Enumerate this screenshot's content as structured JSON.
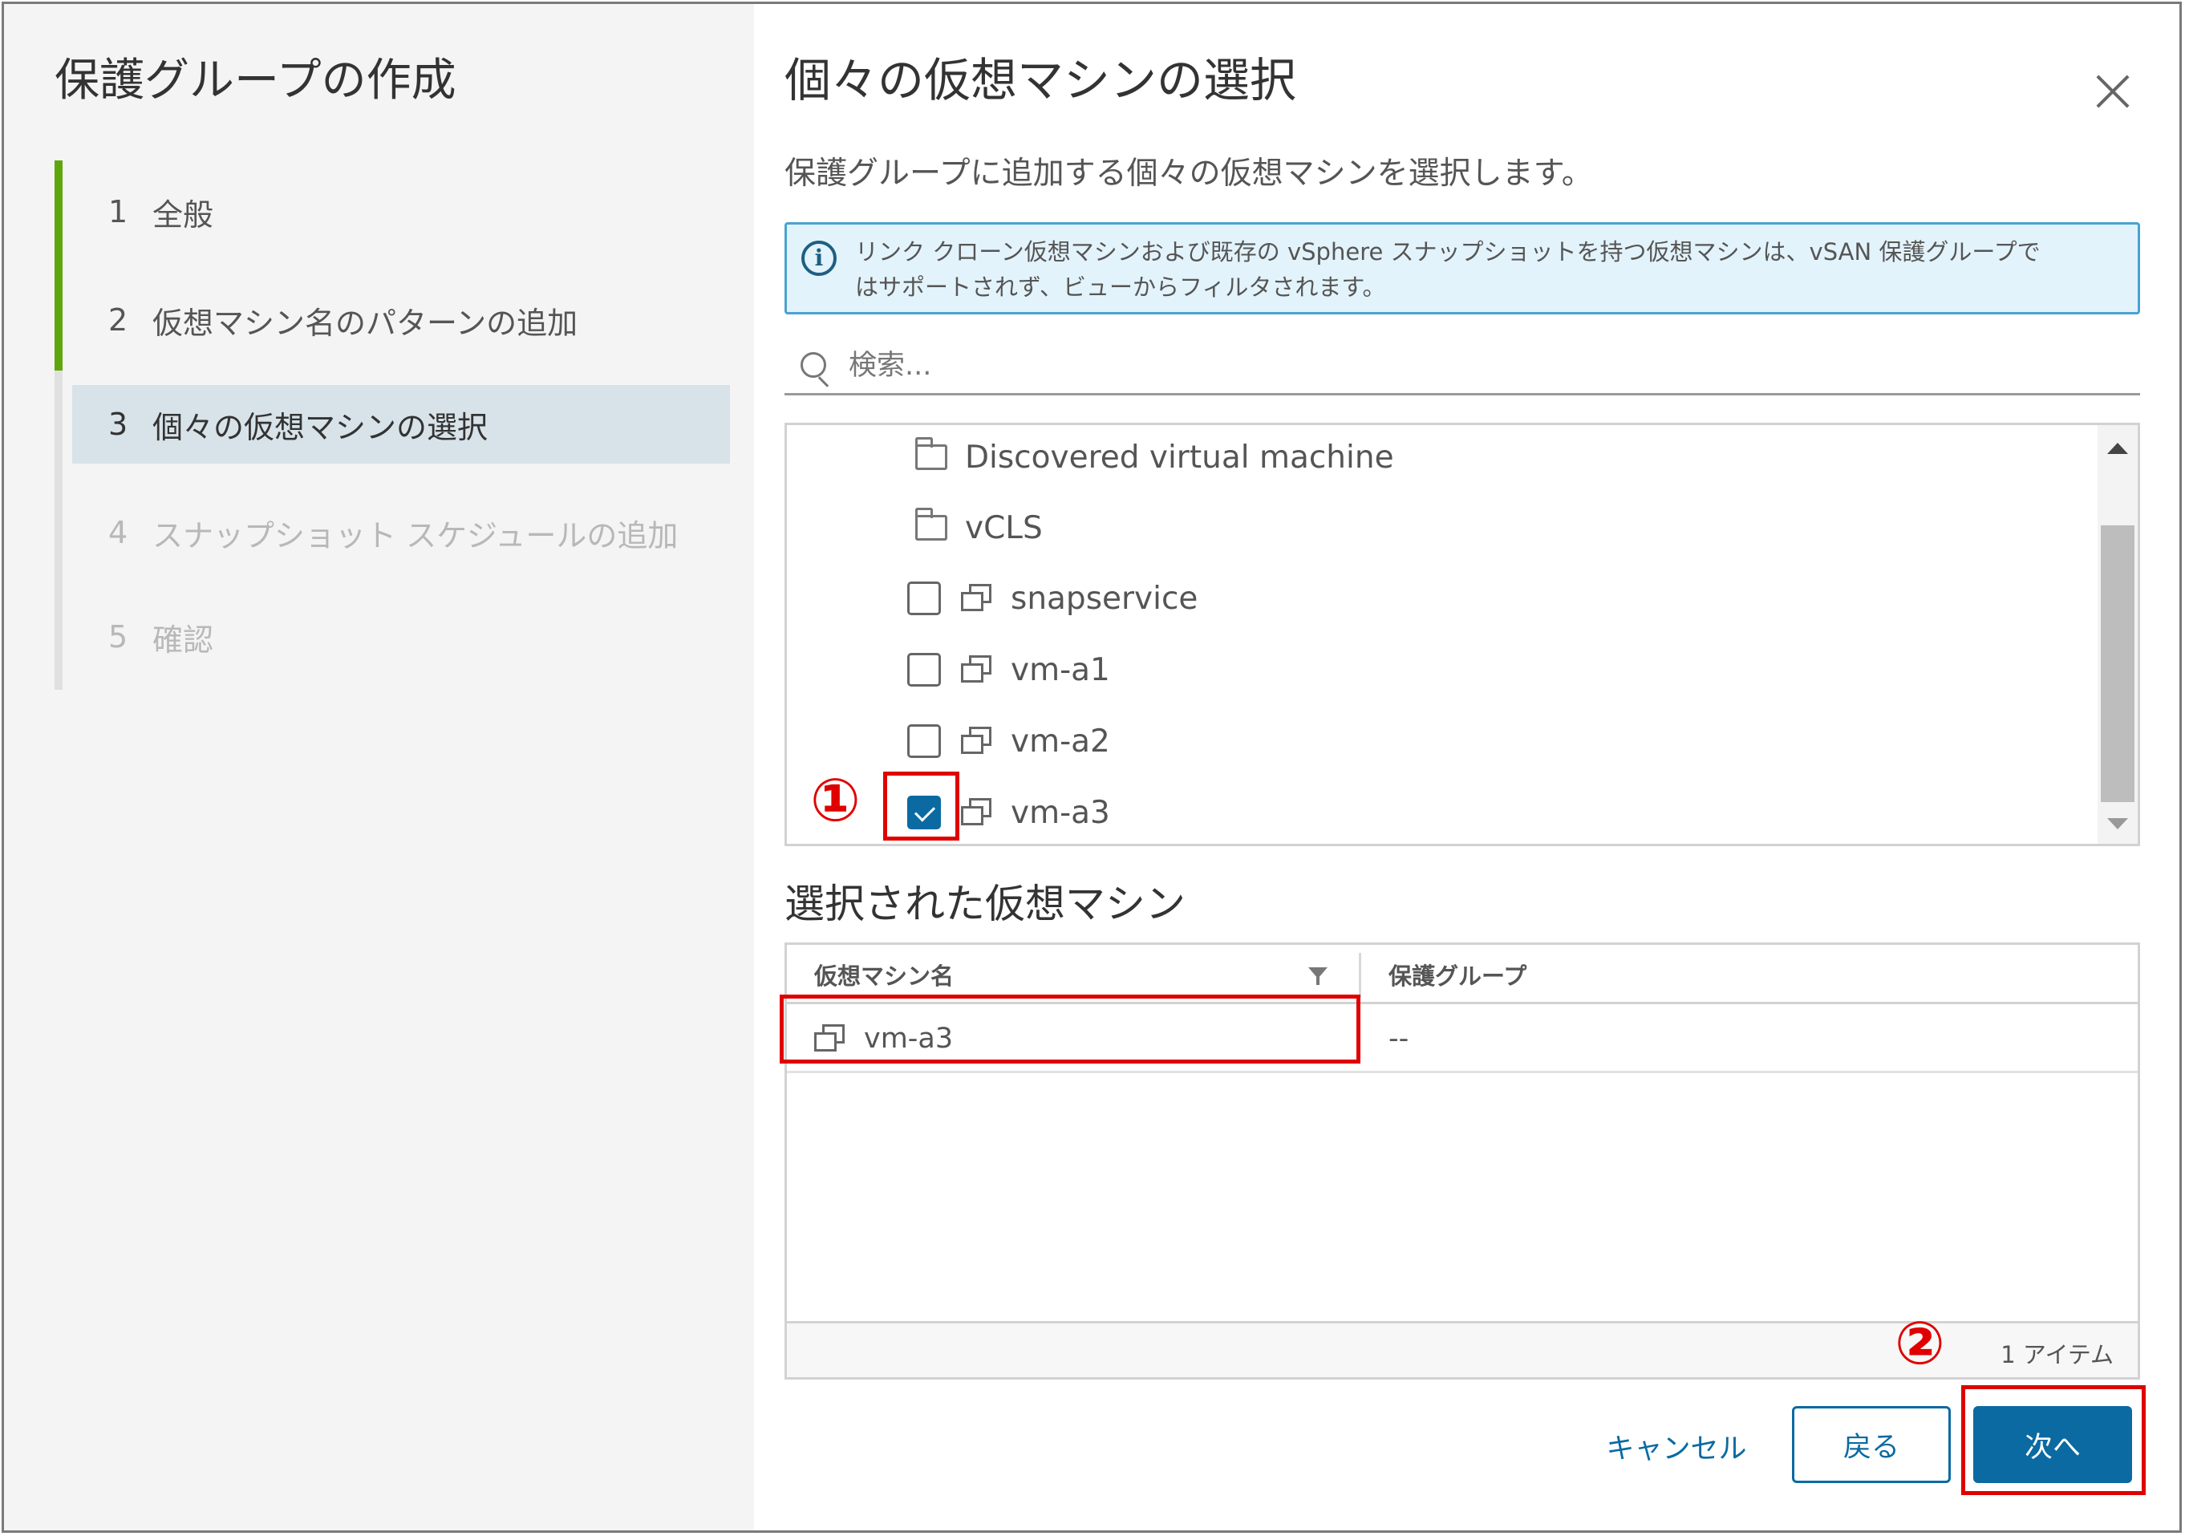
{
  "wizard": {
    "title": "保護グループの作成",
    "steps": [
      {
        "num": "1",
        "label": "全般"
      },
      {
        "num": "2",
        "label": "仮想マシン名のパターンの追加"
      },
      {
        "num": "3",
        "label": "個々の仮想マシンの選択"
      },
      {
        "num": "4",
        "label": "スナップショット スケジュールの追加"
      },
      {
        "num": "5",
        "label": "確認"
      }
    ],
    "current_step": 3
  },
  "page": {
    "title": "個々の仮想マシンの選択",
    "description": "保護グループに追加する個々の仮想マシンを選択します。",
    "info_message": "リンク クローン仮想マシンおよび既存の vSphere スナップショットを持つ仮想マシンは、vSAN 保護グループでははサポートされず、ビューからフィルタされます。",
    "info_line1": "リンク クローン仮想マシンおよび既存の vSphere スナップショットを持つ仮想マシンは、vSAN 保護グループで",
    "info_line2": "はサポートされず、ビューからフィルタされます。"
  },
  "search": {
    "placeholder": "検索...",
    "value": ""
  },
  "tree": {
    "folders": [
      {
        "label": "Discovered virtual machine"
      },
      {
        "label": "vCLS"
      }
    ],
    "vms": [
      {
        "label": "snapservice",
        "checked": false
      },
      {
        "label": "vm-a1",
        "checked": false
      },
      {
        "label": "vm-a2",
        "checked": false
      },
      {
        "label": "vm-a3",
        "checked": true
      }
    ]
  },
  "selected": {
    "title": "選択された仮想マシン",
    "columns": [
      "仮想マシン名",
      "保護グループ"
    ],
    "rows": [
      {
        "name": "vm-a3",
        "group": "--"
      }
    ],
    "footer": "1 アイテム"
  },
  "buttons": {
    "cancel": "キャンセル",
    "back": "戻る",
    "next": "次へ"
  },
  "annotations": {
    "marker1": "①",
    "marker2": "②",
    "color": "#e00000"
  },
  "colors": {
    "accent": "#0b6aa2",
    "progress": "#5ea60a",
    "info_border": "#48a3cf"
  }
}
